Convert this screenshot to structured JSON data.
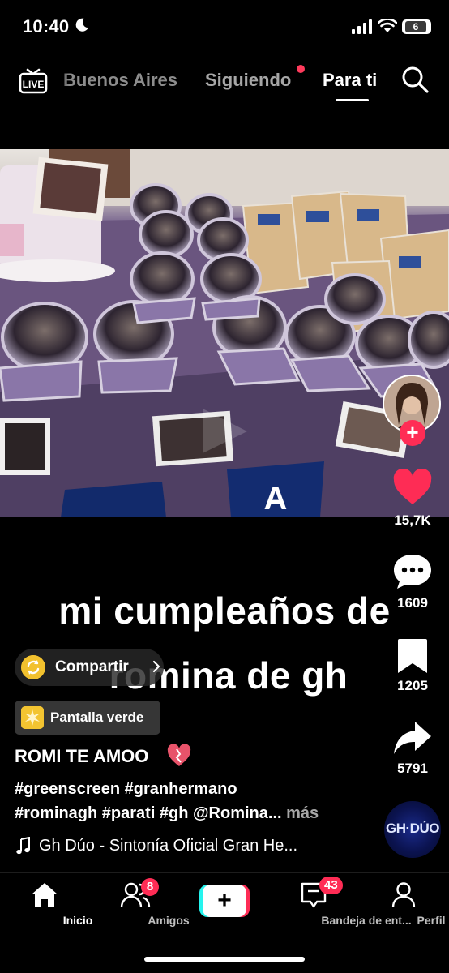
{
  "status_bar": {
    "time": "10:40",
    "battery_level": "6"
  },
  "top_nav": {
    "live_label": "LIVE",
    "tabs": [
      {
        "label": "Buenos Aires"
      },
      {
        "label": "Siguiendo"
      },
      {
        "label": "Para ti"
      }
    ]
  },
  "video": {
    "overlay_line1": "mi cumpleaños de",
    "overlay_line2": "romina de gh",
    "sign_letter": "A"
  },
  "actions": {
    "likes": "15,7K",
    "comments": "1609",
    "bookmarks": "1205",
    "shares": "5791",
    "disc_label": "GH·DÚO"
  },
  "share_pill": {
    "label": "Compartir"
  },
  "effect": {
    "label": "Pantalla verde"
  },
  "caption": {
    "author": "ROMI TE AMOO",
    "hashtags_line1": "#greenscreen #granhermano",
    "hashtags_line2": "#rominagh #parati #gh @Romina...",
    "more": "más",
    "music": "Gh Dúo - Sintonía Oficial Gran He..."
  },
  "bottom_nav": {
    "home": "Inicio",
    "friends": "Amigos",
    "friends_badge": "8",
    "inbox": "Bandeja de ent...",
    "inbox_badge": "43",
    "profile": "Perfil"
  },
  "colors": {
    "accent": "#fe2c55",
    "teal": "#25f4ee",
    "badge_yellow": "#f2c12e"
  }
}
